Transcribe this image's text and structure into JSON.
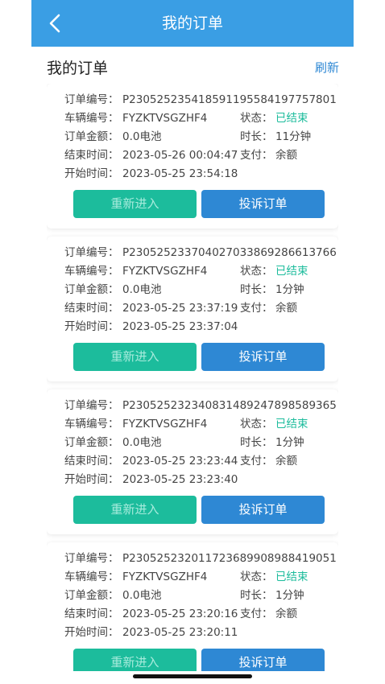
{
  "header": {
    "title": "我的订单"
  },
  "subheader": {
    "title": "我的订单",
    "refresh_label": "刷新"
  },
  "labels": {
    "order_no": "订单编号：",
    "vehicle_no": "车辆编号：",
    "amount": "订单金额：",
    "end_time": "结束时间：",
    "start_time": "开始时间：",
    "status": "状态：",
    "duration": "时长：",
    "payment": "支付：",
    "reenter_button": "重新进入",
    "complain_button": "投诉订单"
  },
  "orders": [
    {
      "order_no": "P230525235418591195584197757801",
      "vehicle_no": "FYZKTVSGZHF4",
      "status": "已结束",
      "amount": "0.0电池",
      "duration": "11分钟",
      "end_time": "2023-05-26 00:04:47",
      "payment": "余额",
      "start_time": "2023-05-25 23:54:18"
    },
    {
      "order_no": "P230525233704027033869286613766",
      "vehicle_no": "FYZKTVSGZHF4",
      "status": "已结束",
      "amount": "0.0电池",
      "duration": "1分钟",
      "end_time": "2023-05-25 23:37:19",
      "payment": "余额",
      "start_time": "2023-05-25 23:37:04"
    },
    {
      "order_no": "P230525232340831489247898589365",
      "vehicle_no": "FYZKTVSGZHF4",
      "status": "已结束",
      "amount": "0.0电池",
      "duration": "1分钟",
      "end_time": "2023-05-25 23:23:44",
      "payment": "余额",
      "start_time": "2023-05-25 23:23:40"
    },
    {
      "order_no": "P230525232011723689908988419051",
      "vehicle_no": "FYZKTVSGZHF4",
      "status": "已结束",
      "amount": "0.0电池",
      "duration": "1分钟",
      "end_time": "2023-05-25 23:20:16",
      "payment": "余额",
      "start_time": "2023-05-25 23:20:11"
    }
  ],
  "colors": {
    "header": "#3a9ee4",
    "status_done": "#1cbc9c",
    "reenter": "#1cbc9c",
    "complain": "#2e88d4"
  }
}
